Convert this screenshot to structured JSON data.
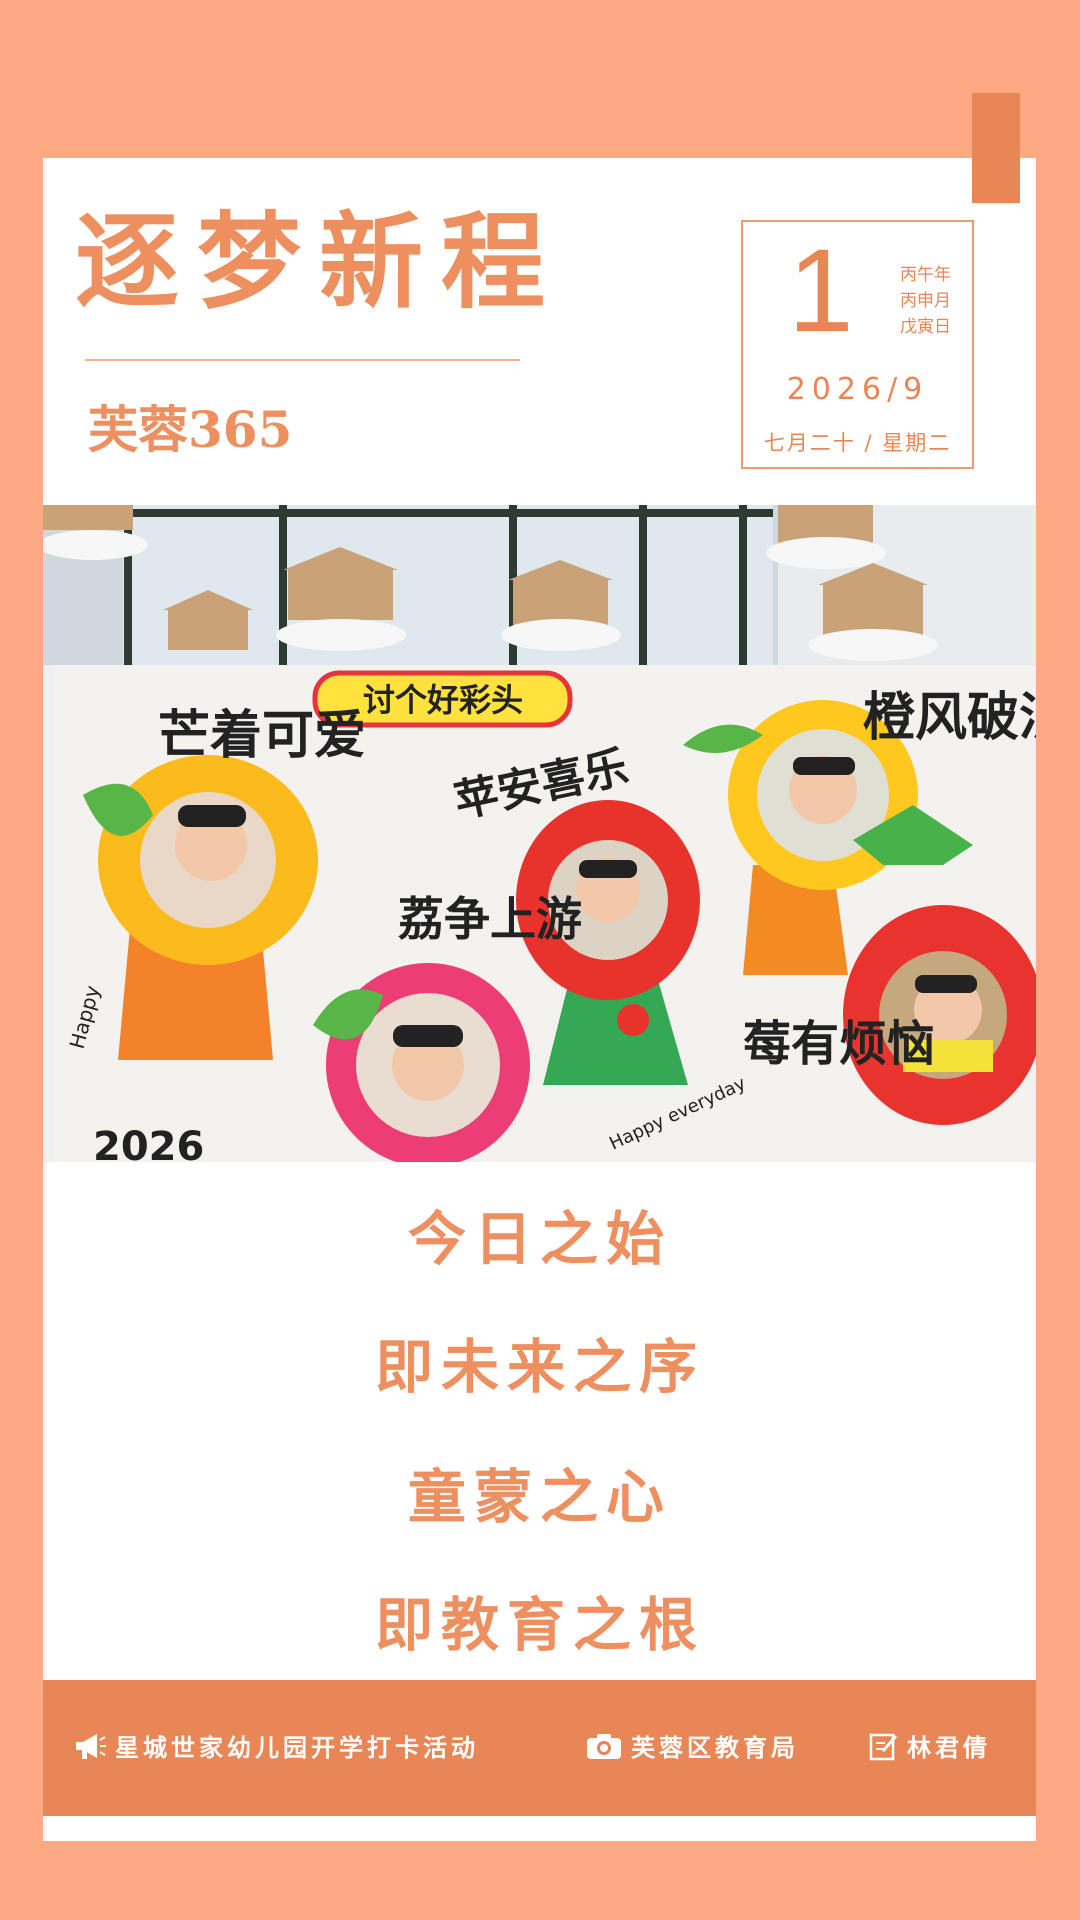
{
  "header": {
    "title": "逐梦新程",
    "subtitle": "芙蓉365"
  },
  "date": {
    "day": "1",
    "ganzhi": [
      "丙午年",
      "丙申月",
      "戊寅日"
    ],
    "year_month": "2026/9",
    "lunar": "七月二十 / 星期二"
  },
  "photo_text": {
    "banner": "讨个好彩头",
    "left_phrase": "芒着可爱",
    "center_phrase": "苹安喜乐",
    "right_phrase": "橙风破浪",
    "bottom_left_phrase": "荔争上游",
    "bottom_right_phrase": "莓有烦恼",
    "year": "2026",
    "happy": "Happy",
    "happy_everyday": "Happy everyday"
  },
  "slogans": [
    "今日之始",
    "即未来之序",
    "童蒙之心",
    "即教育之根"
  ],
  "footer": {
    "activity": "星城世家幼儿园开学打卡活动",
    "bureau": "芙蓉区教育局",
    "author": "林君倩"
  },
  "colors": {
    "background": "#FDA983",
    "accent": "#EE8F60",
    "footer_bg": "#E98656"
  }
}
